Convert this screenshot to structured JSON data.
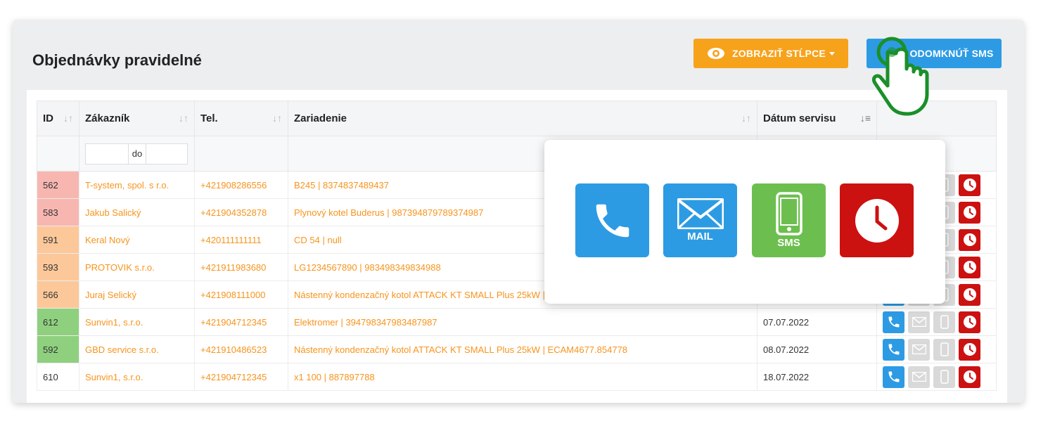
{
  "page": {
    "title": "Objednávky pravidelné",
    "show_columns_label": "ZOBRAZIŤ STĹPCE",
    "unlock_sms_label": "ODOMKNÚŤ SMS"
  },
  "table": {
    "columns": [
      "ID",
      "Zákazník",
      "Tel.",
      "Zariadenie",
      "Dátum servisu"
    ],
    "filter_to_label": "do",
    "rows": [
      {
        "id": "562",
        "customer": "T-system, spol. s r.o.",
        "tel": "+421908286556",
        "device": "B245 | 8374837489437",
        "date": "",
        "status": "red"
      },
      {
        "id": "583",
        "customer": "Jakub Salický",
        "tel": "+421904352878",
        "device": "Plynový kotel Buderus | 987394879789374987",
        "date": "",
        "status": "red"
      },
      {
        "id": "591",
        "customer": "Keral Nový",
        "tel": "+420111111111",
        "device": "CD 54 | null",
        "date": "",
        "status": "orange"
      },
      {
        "id": "593",
        "customer": "PROTOVIK s.r.o.",
        "tel": "+421911983680",
        "device": "LG1234567890 | 983498349834988",
        "date": "",
        "status": "orange"
      },
      {
        "id": "566",
        "customer": "Juraj Selický",
        "tel": "+421908111000",
        "device": "Nástenný kondenzačný kotol ATTACK KT SMALL Plus 25kW | ECAM4677.854778",
        "date": "",
        "status": "orange"
      },
      {
        "id": "612",
        "customer": "Sunvin1, s.r.o.",
        "tel": "+421904712345",
        "device": "Elektromer | 394798347983487987",
        "date": "07.07.2022",
        "status": "green"
      },
      {
        "id": "592",
        "customer": "GBD service s.r.o.",
        "tel": "+421910486523",
        "device": "Nástenný kondenzačný kotol ATTACK KT SMALL Plus 25kW | ECAM4677.854778",
        "date": "08.07.2022",
        "status": "green"
      },
      {
        "id": "610",
        "customer": "Sunvin1, s.r.o.",
        "tel": "+421904712345",
        "device": "x1 100 | 887897788",
        "date": "18.07.2022",
        "status": "none"
      }
    ]
  },
  "popup": {
    "mail_label": "MAIL",
    "sms_label": "SMS"
  },
  "icons": [
    "eye-icon",
    "phone-icon",
    "mail-icon",
    "sms-icon",
    "clock-icon",
    "hand-cursor-icon",
    "sort-icon"
  ],
  "colors": {
    "accent_orange": "#f7a21b",
    "accent_blue": "#2d9be4",
    "sms_green": "#6cbf4f",
    "clock_red": "#cc1111",
    "row_red": "#f8b6b1",
    "row_orange": "#fcc89a",
    "row_green": "#8fd07f"
  }
}
